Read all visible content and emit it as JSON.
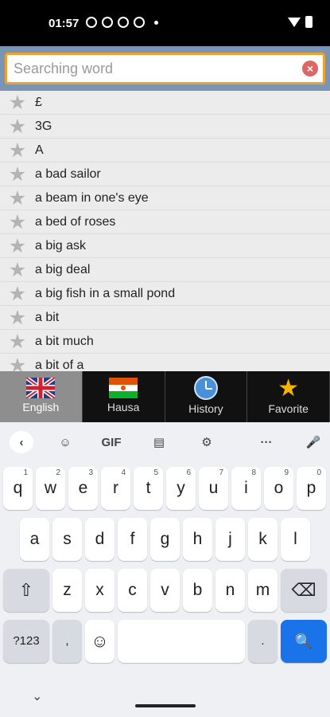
{
  "status_bar": {
    "time": "01:57",
    "icons": [
      "info-icon",
      "notification-icon",
      "app-icon",
      "clipboard-icon",
      "dot-icon"
    ],
    "right_icons": [
      "wifi-icon",
      "battery-icon"
    ]
  },
  "search": {
    "placeholder": "Searching word",
    "value": "",
    "clear_icon": "clear-icon"
  },
  "word_list": [
    "£",
    "3G",
    "A",
    "a bad sailor",
    "a beam in one's eye",
    "a bed of roses",
    "a big ask",
    "a big deal",
    "a big fish in a small pond",
    "a bit",
    "a bit much",
    "a bit of a"
  ],
  "tabs": [
    {
      "label": "English",
      "icon": "uk-flag-icon",
      "active": true
    },
    {
      "label": "Hausa",
      "icon": "niger-flag-icon",
      "active": false
    },
    {
      "label": "History",
      "icon": "clock-icon",
      "active": false
    },
    {
      "label": "Favorite",
      "icon": "star-icon",
      "active": false
    }
  ],
  "keyboard": {
    "toolbar": {
      "back": "‹",
      "sticker": "☺",
      "gif": "GIF",
      "clipboard": "▤",
      "settings": "⚙",
      "more": "···",
      "mic": "🎤"
    },
    "row1": [
      {
        "k": "q",
        "n": "1"
      },
      {
        "k": "w",
        "n": "2"
      },
      {
        "k": "e",
        "n": "3"
      },
      {
        "k": "r",
        "n": "4"
      },
      {
        "k": "t",
        "n": "5"
      },
      {
        "k": "y",
        "n": "6"
      },
      {
        "k": "u",
        "n": "7"
      },
      {
        "k": "i",
        "n": "8"
      },
      {
        "k": "o",
        "n": "9"
      },
      {
        "k": "p",
        "n": "0"
      }
    ],
    "row2": [
      "a",
      "s",
      "d",
      "f",
      "g",
      "h",
      "j",
      "k",
      "l"
    ],
    "row3": [
      "z",
      "x",
      "c",
      "v",
      "b",
      "n",
      "m"
    ],
    "shift": "⇧",
    "backspace": "⌫",
    "symbols": "?123",
    "comma": ",",
    "emoji": "☺",
    "period": ".",
    "search_key": "🔍",
    "hide": "⌄"
  },
  "colors": {
    "search_border": "#f0a030",
    "search_bg_bar": "#7a95b3",
    "active_tab": "#8e8e8e",
    "star_gray": "#b4b4b4",
    "favorite_star": "#f5b400",
    "keyboard_accent": "#1a73e8"
  }
}
